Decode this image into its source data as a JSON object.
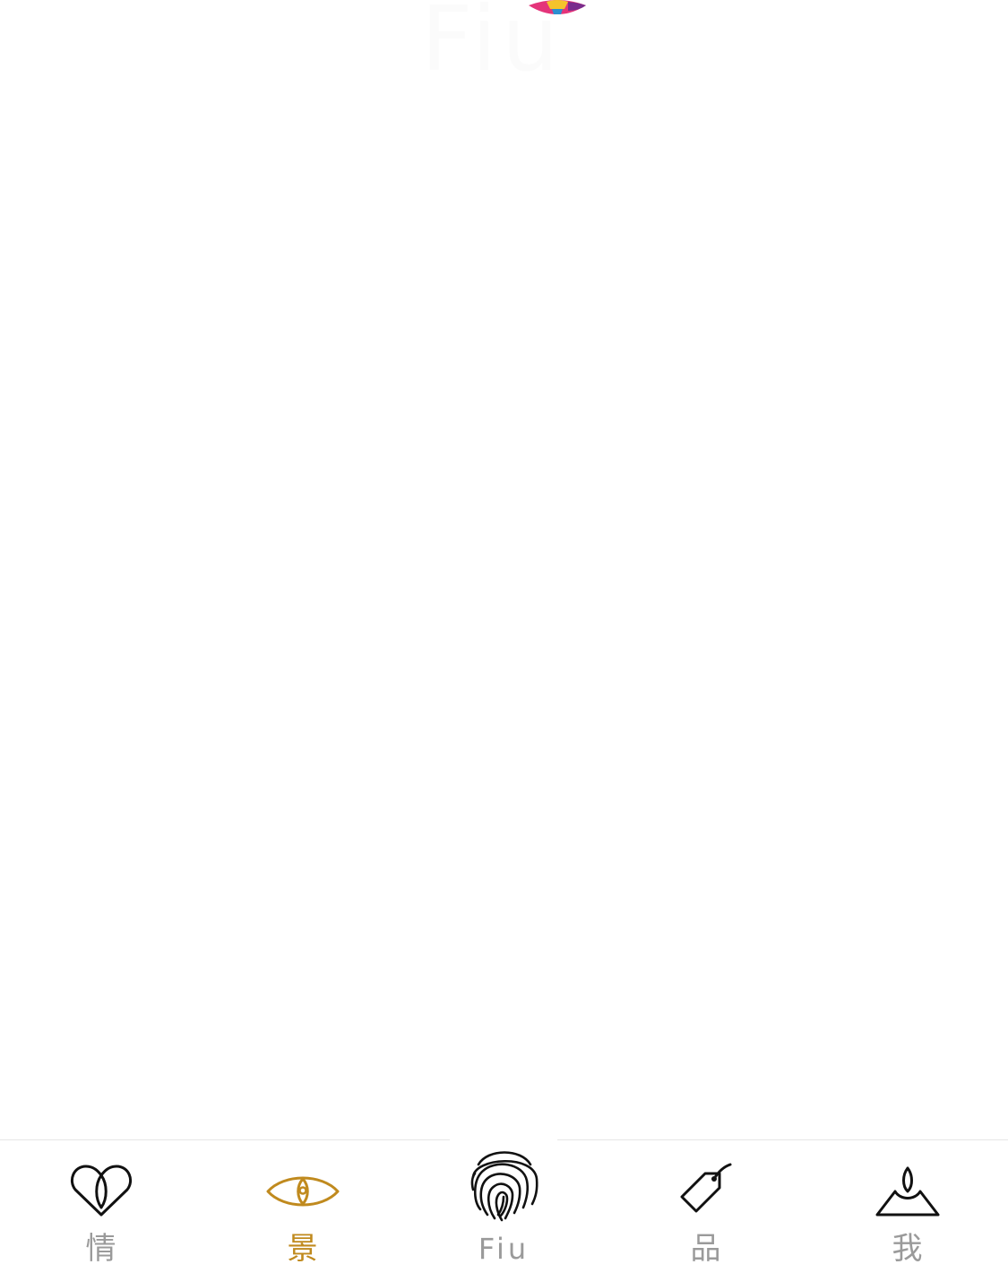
{
  "header": {
    "brand_text": "Fiu",
    "brand_colors": [
      "#e4347a",
      "#f5c32c",
      "#2b8fd1",
      "#7a2c8c"
    ]
  },
  "tabbar": {
    "active_color": "#c08a1e",
    "inactive_color": "#9a9a9a",
    "tabs": [
      {
        "label": "情",
        "icon": "heart-icon",
        "active": false
      },
      {
        "label": "景",
        "icon": "eye-icon",
        "active": true
      },
      {
        "label": "Fiu",
        "icon": "fingerprint-icon",
        "active": false
      },
      {
        "label": "品",
        "icon": "price-tag-icon",
        "active": false
      },
      {
        "label": "我",
        "icon": "mountain-person-icon",
        "active": false
      }
    ]
  }
}
